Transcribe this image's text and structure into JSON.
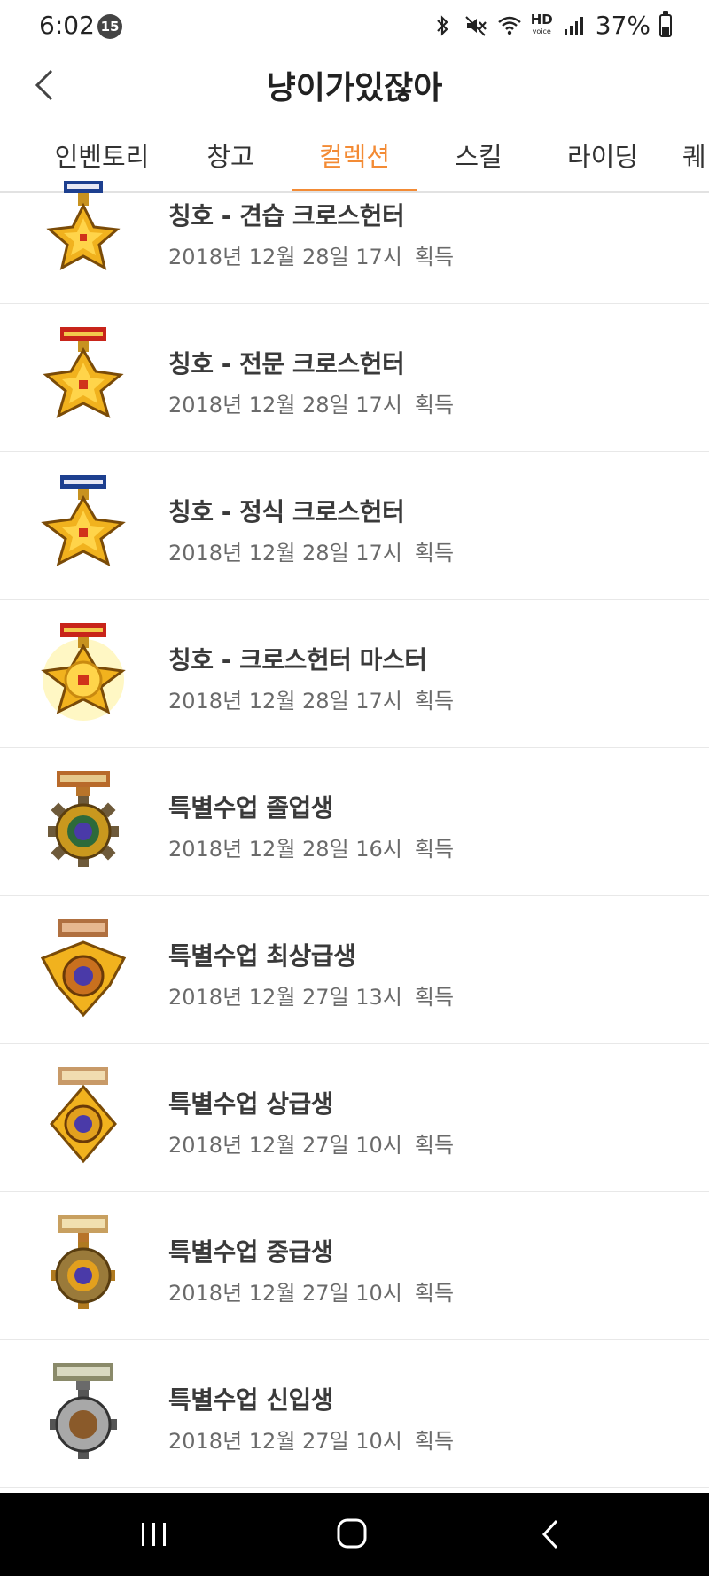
{
  "status_bar": {
    "time": "6:02",
    "notification_count": "15",
    "hd_label": "HD",
    "hd_sub": "voice",
    "battery_percent": "37%",
    "battery_level": 0.37
  },
  "header": {
    "title": "냥이가있잖아"
  },
  "tabs": [
    {
      "label": "인벤토리",
      "active": false
    },
    {
      "label": "창고",
      "active": false
    },
    {
      "label": "컬렉션",
      "active": true
    },
    {
      "label": "스킬",
      "active": false
    },
    {
      "label": "라이딩",
      "active": false
    },
    {
      "label": "퀘",
      "active": false
    }
  ],
  "accent_color": "#f38b35",
  "acquired_label": "획득",
  "items": [
    {
      "title": "칭호 - 견습 크로스헌터",
      "date": "2018년 12월 28일 17시",
      "medal": "star-medal-blue-icon"
    },
    {
      "title": "칭호 - 전문 크로스헌터",
      "date": "2018년 12월 28일 17시",
      "medal": "star-medal-red-icon"
    },
    {
      "title": "칭호 - 정식 크로스헌터",
      "date": "2018년 12월 28일 17시",
      "medal": "star-medal-blue-icon"
    },
    {
      "title": "칭호 - 크로스헌터 마스터",
      "date": "2018년 12월 28일 17시",
      "medal": "star-medal-red-icon"
    },
    {
      "title": "특별수업 졸업생",
      "date": "2018년 12월 28일 16시",
      "medal": "gear-medal-icon"
    },
    {
      "title": "특별수업 최상급생",
      "date": "2018년 12월 27일 13시",
      "medal": "winged-medal-icon"
    },
    {
      "title": "특별수업 상급생",
      "date": "2018년 12월 27일 10시",
      "medal": "gold-medal-icon"
    },
    {
      "title": "특별수업 중급생",
      "date": "2018년 12월 27일 10시",
      "medal": "bronze-gear-medal-icon"
    },
    {
      "title": "특별수업 신입생",
      "date": "2018년 12월 27일 10시",
      "medal": "silver-medal-icon"
    }
  ]
}
